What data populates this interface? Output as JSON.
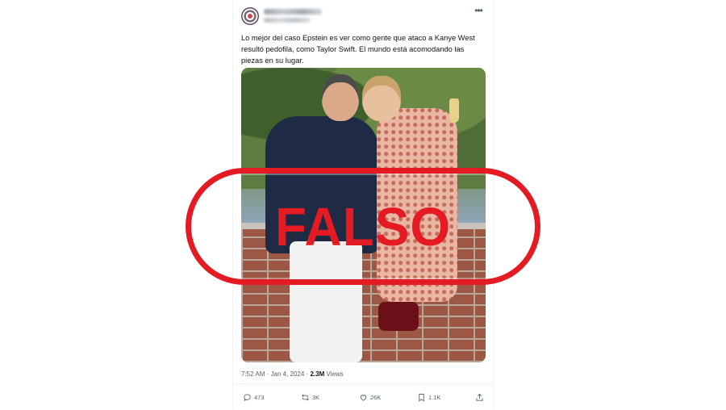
{
  "tweet": {
    "text": "Lo mejor del caso Epstein es ver como gente que ataco a Kanye West resultó pedofila, como Taylor Swift. El mundo está acomodando las piezas en su lugar.",
    "time": "7:52 AM",
    "separator": "·",
    "date": "Jan 4, 2024",
    "separator2": "·",
    "views_count": "2.3M",
    "views_label": "Views"
  },
  "actions": {
    "replies": "473",
    "reposts": "3K",
    "likes": "26K",
    "bookmarks": "1.1K"
  },
  "overlay": {
    "stamp_text": "FALSO",
    "stamp_color": "#e41b23"
  },
  "icons": [
    "more-icon",
    "reply-icon",
    "repost-icon",
    "like-icon",
    "bookmark-icon",
    "share-icon"
  ]
}
